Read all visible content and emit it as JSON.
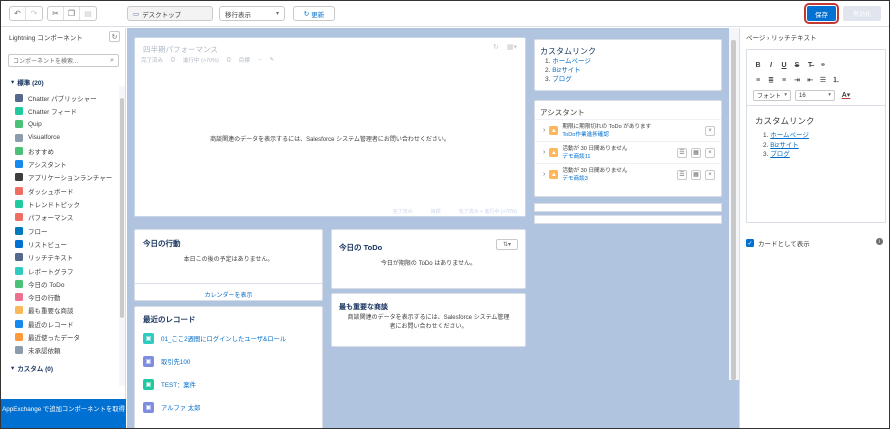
{
  "toolbar": {
    "device_select": "デスクトップ",
    "view_select": "移行表示",
    "refresh_label": "更新",
    "save_label": "保存",
    "activate_label": "有効化"
  },
  "left_panel": {
    "title": "Lightning コンポーネント",
    "search_placeholder": "コンポーネントを検索...",
    "standard_section": "標準 (20)",
    "custom_section": "カスタム (0)",
    "appexchange_label": "AppExchange で追加コンポーネントを取得",
    "items": [
      {
        "label": "Chatter パブリッシャー",
        "color": "#54698d",
        "icon": "chatter-publisher-icon"
      },
      {
        "label": "Chatter フィード",
        "color": "#1fcaa0",
        "icon": "chatter-feed-icon"
      },
      {
        "label": "Quip",
        "color": "#4bc076",
        "icon": "quip-icon"
      },
      {
        "label": "Visualforce",
        "color": "#8b9dad",
        "icon": "visualforce-icon"
      },
      {
        "label": "おすすめ",
        "color": "#4bc076",
        "icon": "recommendation-icon"
      },
      {
        "label": "アシスタント",
        "color": "#1589ee",
        "icon": "assistant-icon"
      },
      {
        "label": "アプリケーションランチャー",
        "color": "#3e3e3c",
        "icon": "app-launcher-icon"
      },
      {
        "label": "ダッシュボード",
        "color": "#ef6e64",
        "icon": "dashboard-icon"
      },
      {
        "label": "トレンドトピック",
        "color": "#1fcaa0",
        "icon": "trending-topic-icon"
      },
      {
        "label": "パフォーマンス",
        "color": "#ef6e64",
        "icon": "performance-icon"
      },
      {
        "label": "フロー",
        "color": "#0079bc",
        "icon": "flow-icon"
      },
      {
        "label": "リストビュー",
        "color": "#0070d2",
        "icon": "list-view-icon"
      },
      {
        "label": "リッチテキスト",
        "color": "#54698d",
        "icon": "rich-text-icon"
      },
      {
        "label": "レポートグラフ",
        "color": "#2ecbbe",
        "icon": "report-chart-icon"
      },
      {
        "label": "今日の ToDo",
        "color": "#4bc076",
        "icon": "today-todo-icon"
      },
      {
        "label": "今日の行動",
        "color": "#eb7092",
        "icon": "today-event-icon"
      },
      {
        "label": "最も重要な商談",
        "color": "#fcb95b",
        "icon": "key-deals-icon"
      },
      {
        "label": "最近のレコード",
        "color": "#1589ee",
        "icon": "recent-records-icon"
      },
      {
        "label": "最近使ったデータ",
        "color": "#ff9a3c",
        "icon": "recent-data-icon"
      },
      {
        "label": "未承認依頼",
        "color": "#8b9dad",
        "icon": "pending-approvals-icon"
      }
    ]
  },
  "canvas": {
    "performance": {
      "title": "四半期パフォーマンス",
      "closed_label": "完了済み",
      "closed_value": "0",
      "open_label": "進行中 (>70%)",
      "open_value": "0",
      "goal_label": "目標",
      "goal_value": "--",
      "message": "商談関連のデータを表示するには、Salesforce システム管理者にお問い合わせください。",
      "legend": [
        "完了済み",
        "目標",
        "完了済み + 進行中 (>70%)"
      ]
    },
    "custom_links": {
      "title": "カスタムリンク",
      "links": [
        "ホームページ",
        "Bizサイト",
        "ブログ"
      ]
    },
    "assistant": {
      "title": "アシスタント",
      "items": [
        {
          "text": "期限に期限切れの ToDo があります",
          "link": "ToDo作業進捗確認"
        },
        {
          "text": "活動が 30 日間ありません",
          "link": "デモ商談11"
        },
        {
          "text": "活動が 30 日間ありません",
          "link": "デモ商談3"
        }
      ]
    },
    "today_events": {
      "title": "今日の行動",
      "message": "本日この後の予定はありません。",
      "footer": "カレンダーを表示"
    },
    "today_todo": {
      "title": "今日の ToDo",
      "message": "今日が期限の ToDo はありません。"
    },
    "key_deals": {
      "title": "最も重要な商談",
      "message": "商談関連のデータを表示するには、Salesforce システム管理者にお問い合わせください。"
    },
    "recent_records": {
      "title": "最近のレコード",
      "items": [
        {
          "label": "01_ここ2週間にログインしたユーザ&ロール",
          "color": "#2ecbbe"
        },
        {
          "label": "取引先100",
          "color": "#7f8de1"
        },
        {
          "label": "TEST：案件",
          "color": "#1fcaa0"
        },
        {
          "label": "アルファ 太郎",
          "color": "#7f8de1"
        }
      ]
    }
  },
  "right_panel": {
    "breadcrumb": "ページ › リッチテキスト",
    "font_select": "フォント",
    "size_select": "16",
    "rte_title": "カスタムリンク",
    "rte_links": [
      "ホームページ",
      "Bizサイト",
      "ブログ"
    ],
    "card_checkbox_label": "カードとして表示"
  }
}
